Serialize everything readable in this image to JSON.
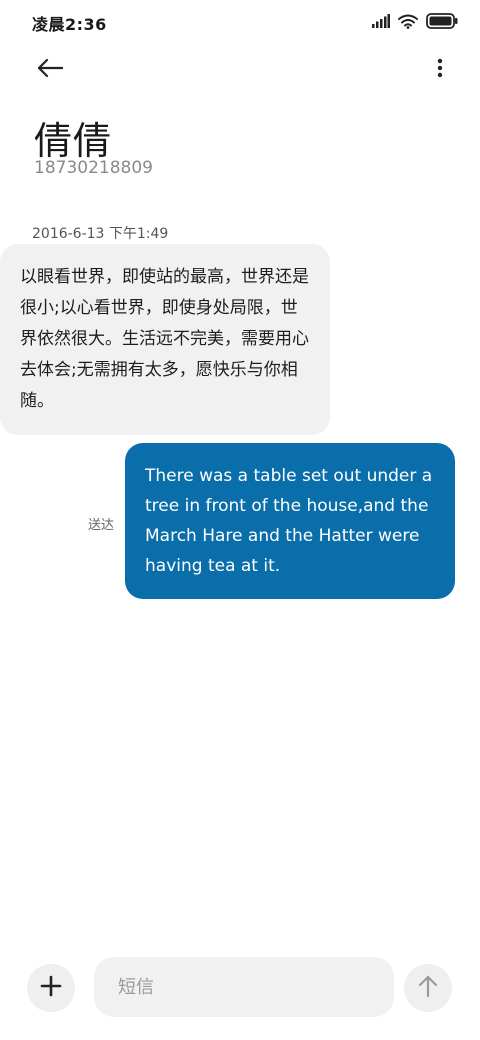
{
  "status_bar": {
    "time": "凌晨2:36",
    "icons": [
      "signal-icon",
      "wifi-icon",
      "battery-icon"
    ]
  },
  "app_bar": {
    "back_icon": "arrow-left-icon",
    "more_icon": "more-vertical-icon"
  },
  "contact": {
    "name": "倩倩",
    "number": "18730218809"
  },
  "conversation": {
    "timestamp": "2016-6-13 下午1:49",
    "messages": [
      {
        "direction": "incoming",
        "text": "以眼看世界，即使站的最高，世界还是很小;以心看世界，即使身处局限，世界依然很大。生活远不完美，需要用心去体会;无需拥有太多，愿快乐与你相随。"
      },
      {
        "direction": "outgoing",
        "status": "送达",
        "text": "There was a table set out under a tree in front of the house,and the March Hare and the Hatter were having tea at it."
      }
    ]
  },
  "composer": {
    "add_icon": "plus-icon",
    "placeholder": "短信",
    "value": "",
    "send_icon": "arrow-up-icon"
  },
  "colors": {
    "outgoing_bubble": "#0a6eab",
    "incoming_bubble": "#f1f1f1",
    "background": "#ffffff"
  }
}
